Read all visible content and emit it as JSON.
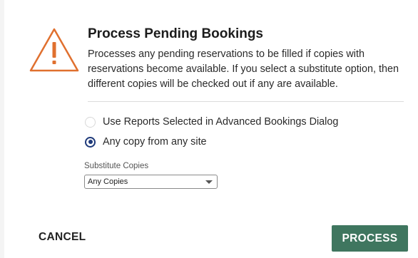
{
  "dialog": {
    "title": "Process Pending Bookings",
    "description": "Processes any pending reservations to be filled if copies with reservations become available. If you select a substitute option, then different copies will be checked out if any are available.",
    "icon": "warning-triangle-icon",
    "options": [
      {
        "label": "Use Reports Selected in Advanced Bookings Dialog",
        "selected": false
      },
      {
        "label": "Any copy from any site",
        "selected": true
      }
    ],
    "substitute": {
      "label": "Substitute Copies",
      "value": "Any Copies"
    },
    "cancel_label": "CANCEL",
    "process_label": "PROCESS"
  },
  "colors": {
    "warning": "#e0702f",
    "accent": "#1f3a7a",
    "primary_button": "#3f765f"
  }
}
